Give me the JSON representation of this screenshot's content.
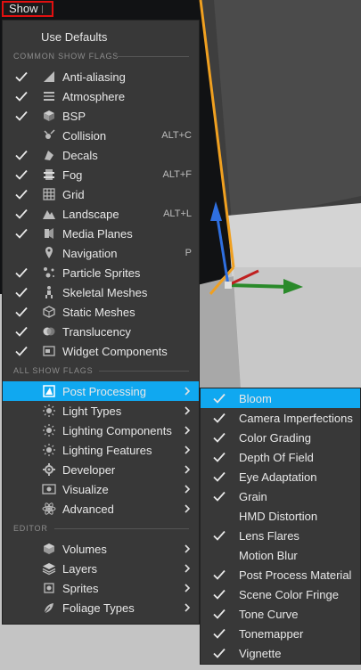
{
  "toolbar": {
    "show_label": "Show"
  },
  "main_menu": {
    "use_defaults": "Use Defaults",
    "common_header": "COMMON SHOW FLAGS",
    "common_items": [
      {
        "label": "Anti-aliasing",
        "checked": true,
        "icon": "antialias-icon",
        "shortcut": ""
      },
      {
        "label": "Atmosphere",
        "checked": true,
        "icon": "atmosphere-icon",
        "shortcut": ""
      },
      {
        "label": "BSP",
        "checked": true,
        "icon": "bsp-icon",
        "shortcut": ""
      },
      {
        "label": "Collision",
        "checked": false,
        "icon": "collision-icon",
        "shortcut": "ALT+C"
      },
      {
        "label": "Decals",
        "checked": true,
        "icon": "decals-icon",
        "shortcut": ""
      },
      {
        "label": "Fog",
        "checked": true,
        "icon": "fog-icon",
        "shortcut": "ALT+F"
      },
      {
        "label": "Grid",
        "checked": true,
        "icon": "grid-icon",
        "shortcut": ""
      },
      {
        "label": "Landscape",
        "checked": true,
        "icon": "landscape-icon",
        "shortcut": "ALT+L"
      },
      {
        "label": "Media Planes",
        "checked": true,
        "icon": "media-planes-icon",
        "shortcut": ""
      },
      {
        "label": "Navigation",
        "checked": false,
        "icon": "navigation-icon",
        "shortcut": "P"
      },
      {
        "label": "Particle Sprites",
        "checked": true,
        "icon": "particle-sprites-icon",
        "shortcut": ""
      },
      {
        "label": "Skeletal Meshes",
        "checked": true,
        "icon": "skeletal-meshes-icon",
        "shortcut": ""
      },
      {
        "label": "Static Meshes",
        "checked": true,
        "icon": "static-meshes-icon",
        "shortcut": ""
      },
      {
        "label": "Translucency",
        "checked": true,
        "icon": "translucency-icon",
        "shortcut": ""
      },
      {
        "label": "Widget Components",
        "checked": true,
        "icon": "widget-components-icon",
        "shortcut": ""
      }
    ],
    "all_header": "ALL SHOW FLAGS",
    "all_items": [
      {
        "label": "Post Processing",
        "icon": "post-processing-icon",
        "active": true
      },
      {
        "label": "Light Types",
        "icon": "light-types-icon",
        "active": false
      },
      {
        "label": "Lighting Components",
        "icon": "lighting-components-icon",
        "active": false
      },
      {
        "label": "Lighting Features",
        "icon": "lighting-features-icon",
        "active": false
      },
      {
        "label": "Developer",
        "icon": "developer-icon",
        "active": false
      },
      {
        "label": "Visualize",
        "icon": "visualize-icon",
        "active": false
      },
      {
        "label": "Advanced",
        "icon": "advanced-icon",
        "active": false
      }
    ],
    "editor_header": "EDITOR",
    "editor_items": [
      {
        "label": "Volumes",
        "icon": "volumes-icon"
      },
      {
        "label": "Layers",
        "icon": "layers-icon"
      },
      {
        "label": "Sprites",
        "icon": "sprites-icon"
      },
      {
        "label": "Foliage Types",
        "icon": "foliage-types-icon"
      }
    ]
  },
  "post_processing_menu": {
    "items": [
      {
        "label": "Bloom",
        "checked": true,
        "active": true
      },
      {
        "label": "Camera Imperfections",
        "checked": true,
        "active": false
      },
      {
        "label": "Color Grading",
        "checked": true,
        "active": false
      },
      {
        "label": "Depth Of Field",
        "checked": true,
        "active": false
      },
      {
        "label": "Eye Adaptation",
        "checked": true,
        "active": false
      },
      {
        "label": "Grain",
        "checked": true,
        "active": false
      },
      {
        "label": "HMD Distortion",
        "checked": false,
        "active": false
      },
      {
        "label": "Lens Flares",
        "checked": true,
        "active": false
      },
      {
        "label": "Motion Blur",
        "checked": false,
        "active": false
      },
      {
        "label": "Post Process Material",
        "checked": true,
        "active": false
      },
      {
        "label": "Scene Color Fringe",
        "checked": true,
        "active": false
      },
      {
        "label": "Tone Curve",
        "checked": true,
        "active": false
      },
      {
        "label": "Tonemapper",
        "checked": true,
        "active": false
      },
      {
        "label": "Vignette",
        "checked": true,
        "active": false
      }
    ]
  },
  "colors": {
    "highlight": "#10a8f0",
    "menu_bg": "#383838",
    "selection_orange": "#f0a020",
    "focus_red": "#e01010"
  }
}
